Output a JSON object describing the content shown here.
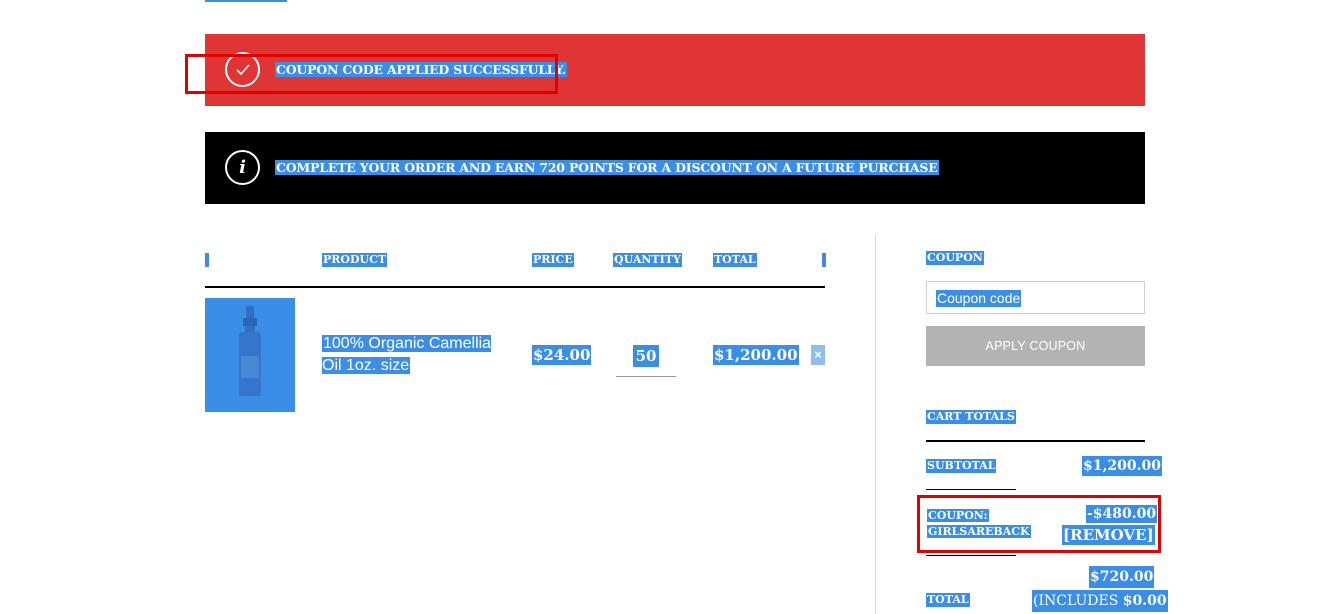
{
  "notices": {
    "success": {
      "icon": "check-circle-icon",
      "text": "COUPON CODE APPLIED SUCCESSFULLY.",
      "color": "#e03535"
    },
    "info": {
      "icon": "info-circle-icon",
      "text": "COMPLETE YOUR ORDER AND EARN 720 POINTS FOR A DISCOUNT ON A FUTURE PURCHASE",
      "color": "#000000"
    }
  },
  "cart_table": {
    "headers": {
      "product": "PRODUCT",
      "price": "PRICE",
      "quantity": "QUANTITY",
      "total": "TOTAL"
    },
    "rows": [
      {
        "name": "100% Organic Camellia Oil 1oz. size",
        "price": "$24.00",
        "quantity": "50",
        "total": "$1,200.00",
        "remove": "×"
      }
    ]
  },
  "coupon": {
    "label": "COUPON",
    "placeholder": "Coupon code",
    "apply_label": "APPLY COUPON"
  },
  "cart_totals": {
    "label": "CART TOTALS",
    "subtotal_label": "SUBTOTAL",
    "subtotal_value": "$1,200.00",
    "coupon_label_1": "COUPON:",
    "coupon_label_2": "GIRLSAREBACK",
    "coupon_discount": "-$480.00",
    "coupon_remove": "[REMOVE]",
    "total_label": "TOTAL",
    "total_value": "$720.00",
    "total_includes_prefix": "(INCLUDES",
    "total_includes_value": "$0.00"
  },
  "colors": {
    "selection": "#3b8ee8",
    "highlight_box": "#e00000",
    "button_disabled": "#b3b3b3"
  }
}
